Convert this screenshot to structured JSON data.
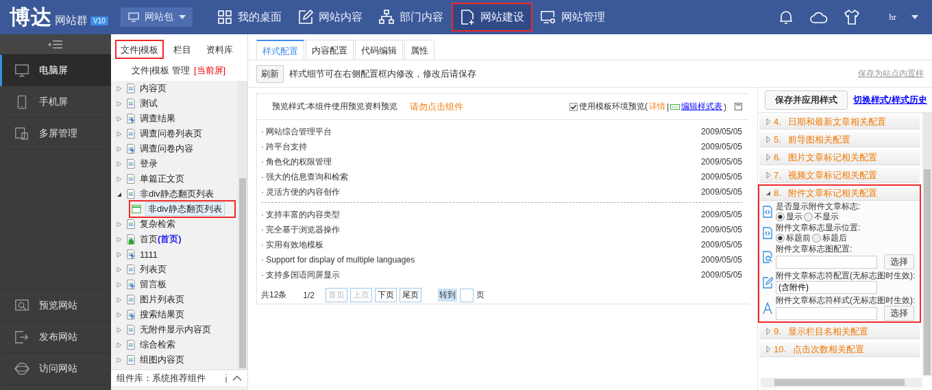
{
  "header": {
    "logo": "博达",
    "product": "网站群",
    "version": "V10",
    "site_selector": "网站包",
    "user": "hr",
    "nav": [
      {
        "label": "我的桌面",
        "highlighted": false
      },
      {
        "label": "网站内容",
        "highlighted": false
      },
      {
        "label": "部门内容",
        "highlighted": false
      },
      {
        "label": "网站建设",
        "highlighted": true
      },
      {
        "label": "网站管理",
        "highlighted": false
      }
    ]
  },
  "sidebar": {
    "items": [
      {
        "label": "电脑屏",
        "selected": true
      },
      {
        "label": "手机屏",
        "selected": false
      },
      {
        "label": "多屏管理",
        "selected": false
      }
    ],
    "bottom_items": [
      {
        "label": "预览网站"
      },
      {
        "label": "发布网站"
      },
      {
        "label": "访问网站"
      }
    ]
  },
  "tree_panel": {
    "tabs": [
      {
        "label": "文件|模板",
        "highlighted": true
      },
      {
        "label": "栏目",
        "highlighted": false
      },
      {
        "label": "资料库",
        "highlighted": false
      }
    ],
    "title": "文件|模板 管理",
    "title_badge": "[当前屏]",
    "items": [
      {
        "label": "内容页",
        "kind": "doc",
        "expanded": false
      },
      {
        "label": "测试",
        "kind": "doc",
        "expanded": false
      },
      {
        "label": "调查结果",
        "kind": "dynamic",
        "expanded": false
      },
      {
        "label": "调查问卷列表页",
        "kind": "doc",
        "expanded": false
      },
      {
        "label": "调查问卷内容",
        "kind": "dynamic",
        "expanded": false
      },
      {
        "label": "登录",
        "kind": "doc",
        "expanded": false
      },
      {
        "label": "单篇正文页",
        "kind": "doc",
        "expanded": false
      },
      {
        "label": "非div静态翻页列表",
        "kind": "doc",
        "expanded": true,
        "children": [
          {
            "label": "非div静态翻页列表",
            "kind": "component",
            "highlighted": true
          }
        ]
      },
      {
        "label": "复杂检索",
        "kind": "doc",
        "expanded": false
      },
      {
        "label": "首页",
        "tag": "(首页)",
        "kind": "home",
        "expanded": false
      },
      {
        "label": "1111",
        "kind": "dynamic",
        "expanded": false
      },
      {
        "label": "列表页",
        "kind": "doc",
        "expanded": false
      },
      {
        "label": "留言板",
        "kind": "dynamic",
        "expanded": false
      },
      {
        "label": "图片列表页",
        "kind": "doc",
        "expanded": false
      },
      {
        "label": "搜索结果页",
        "kind": "dynamic",
        "expanded": false
      },
      {
        "label": "无附件显示内容页",
        "kind": "doc",
        "expanded": false
      },
      {
        "label": "综合检索",
        "kind": "doc",
        "expanded": false
      },
      {
        "label": "组图内容页",
        "kind": "doc",
        "expanded": false
      }
    ],
    "library": "组件库：系统推荐组件"
  },
  "main": {
    "tabs": [
      {
        "label": "样式配置",
        "selected": true
      },
      {
        "label": "内容配置",
        "selected": false
      },
      {
        "label": "代码编辑",
        "selected": false
      },
      {
        "label": "属性",
        "selected": false
      }
    ],
    "refresh_button": "刷新",
    "hint": "样式细节可在右侧配置框内修改，修改后请保存",
    "save_builtin_link": "保存为站点内置样",
    "preview": {
      "label": "预览样式:本组件使用预览资料预览",
      "warning": "请勿点击组件",
      "env_checked": true,
      "env_label": "使用模板环境预览(",
      "details_link": "详情",
      "separator": "|",
      "stylesheet_link": "编辑样式表",
      "close_paren": ")",
      "groups": [
        [
          {
            "title": "· 网站综合管理平台",
            "date": "2009/05/05"
          },
          {
            "title": "· 跨平台支持",
            "date": "2009/05/05"
          },
          {
            "title": "· 角色化的权限管理",
            "date": "2009/05/05"
          },
          {
            "title": "· 强大的信息查询和检索",
            "date": "2009/05/05"
          },
          {
            "title": "· 灵活方便的内容创作",
            "date": "2009/05/05"
          }
        ],
        [
          {
            "title": "· 支持丰富的内容类型",
            "date": "2009/05/05"
          },
          {
            "title": "· 完全基于浏览器操作",
            "date": "2009/05/05"
          },
          {
            "title": "· 实用有效地模板",
            "date": "2009/05/05"
          },
          {
            "title": "· Support for display of multiple languages",
            "date": "2009/05/05"
          },
          {
            "title": "· 支持多国语同屏显示",
            "date": "2009/05/05"
          }
        ]
      ],
      "pager": {
        "total": "共12条",
        "page": "1/2",
        "buttons": [
          {
            "label": "首页",
            "disabled": true
          },
          {
            "label": "上页",
            "disabled": true
          },
          {
            "label": "下页",
            "disabled": false
          },
          {
            "label": "尾页",
            "disabled": false
          }
        ],
        "goto": "转到",
        "goto_suffix": "页"
      }
    }
  },
  "config": {
    "save_button": "保存并应用样式",
    "history_link": "切换样式/样式历史",
    "groups": [
      {
        "number": "4.",
        "label": "日期和最新文章相关配置",
        "expanded": false,
        "highlighted": false
      },
      {
        "number": "5.",
        "label": "前导图相关配置",
        "expanded": false,
        "highlighted": false
      },
      {
        "number": "6.",
        "label": "图片文章标记相关配置",
        "expanded": false,
        "highlighted": false
      },
      {
        "number": "7.",
        "label": "视频文章标记相关配置",
        "expanded": false,
        "highlighted": false
      },
      {
        "number": "8.",
        "label": "附件文章标记相关配置",
        "expanded": true,
        "highlighted": true,
        "fields": [
          {
            "kind": "radio",
            "label": "是否显示附件文章标志:",
            "options": [
              {
                "label": "显示",
                "selected": true
              },
              {
                "label": "不显示",
                "selected": false
              }
            ]
          },
          {
            "kind": "radio",
            "label": "附件文章标志显示位置:",
            "options": [
              {
                "label": "标题前",
                "selected": true
              },
              {
                "label": "标题后",
                "selected": false
              }
            ]
          },
          {
            "kind": "picker",
            "label": "附件文章标志图配置:",
            "button": "选择"
          },
          {
            "kind": "text",
            "label": "附件文章标志符配置(无标志图时生效):",
            "value": "(含附件)"
          },
          {
            "kind": "picker",
            "label": "附件文章标志符样式(无标志图时生效):",
            "button": "选择"
          }
        ]
      },
      {
        "number": "9.",
        "label": "显示栏目名相关配置",
        "expanded": false,
        "highlighted": false
      },
      {
        "number": "10.",
        "label": "点击次数相关配置",
        "expanded": false,
        "highlighted": false
      }
    ]
  }
}
